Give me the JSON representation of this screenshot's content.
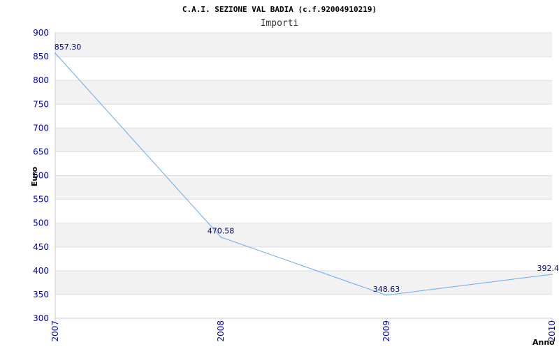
{
  "chart_data": {
    "type": "line",
    "title": "C.A.I. SEZIONE VAL BADIA (c.f.92004910219)",
    "subtitle": "Importi",
    "xlabel": "Anno",
    "ylabel": "Euro",
    "categories": [
      "2007",
      "2008",
      "2009",
      "2010"
    ],
    "series": [
      {
        "values": [
          857.3,
          470.58,
          348.63,
          392.4
        ],
        "labels": [
          "857.30",
          "470.58",
          "348.63",
          "392.4"
        ]
      }
    ],
    "ylim": [
      300,
      900
    ],
    "yticks": [
      "300",
      "350",
      "400",
      "450",
      "500",
      "550",
      "600",
      "650",
      "700",
      "750",
      "800",
      "850",
      "900"
    ],
    "grid": true,
    "colors": {
      "line": "#66aaee",
      "band_alt": "#f2f2f2",
      "grid": "#dddddd",
      "tick": "#0000aa",
      "label": "#000080"
    }
  }
}
